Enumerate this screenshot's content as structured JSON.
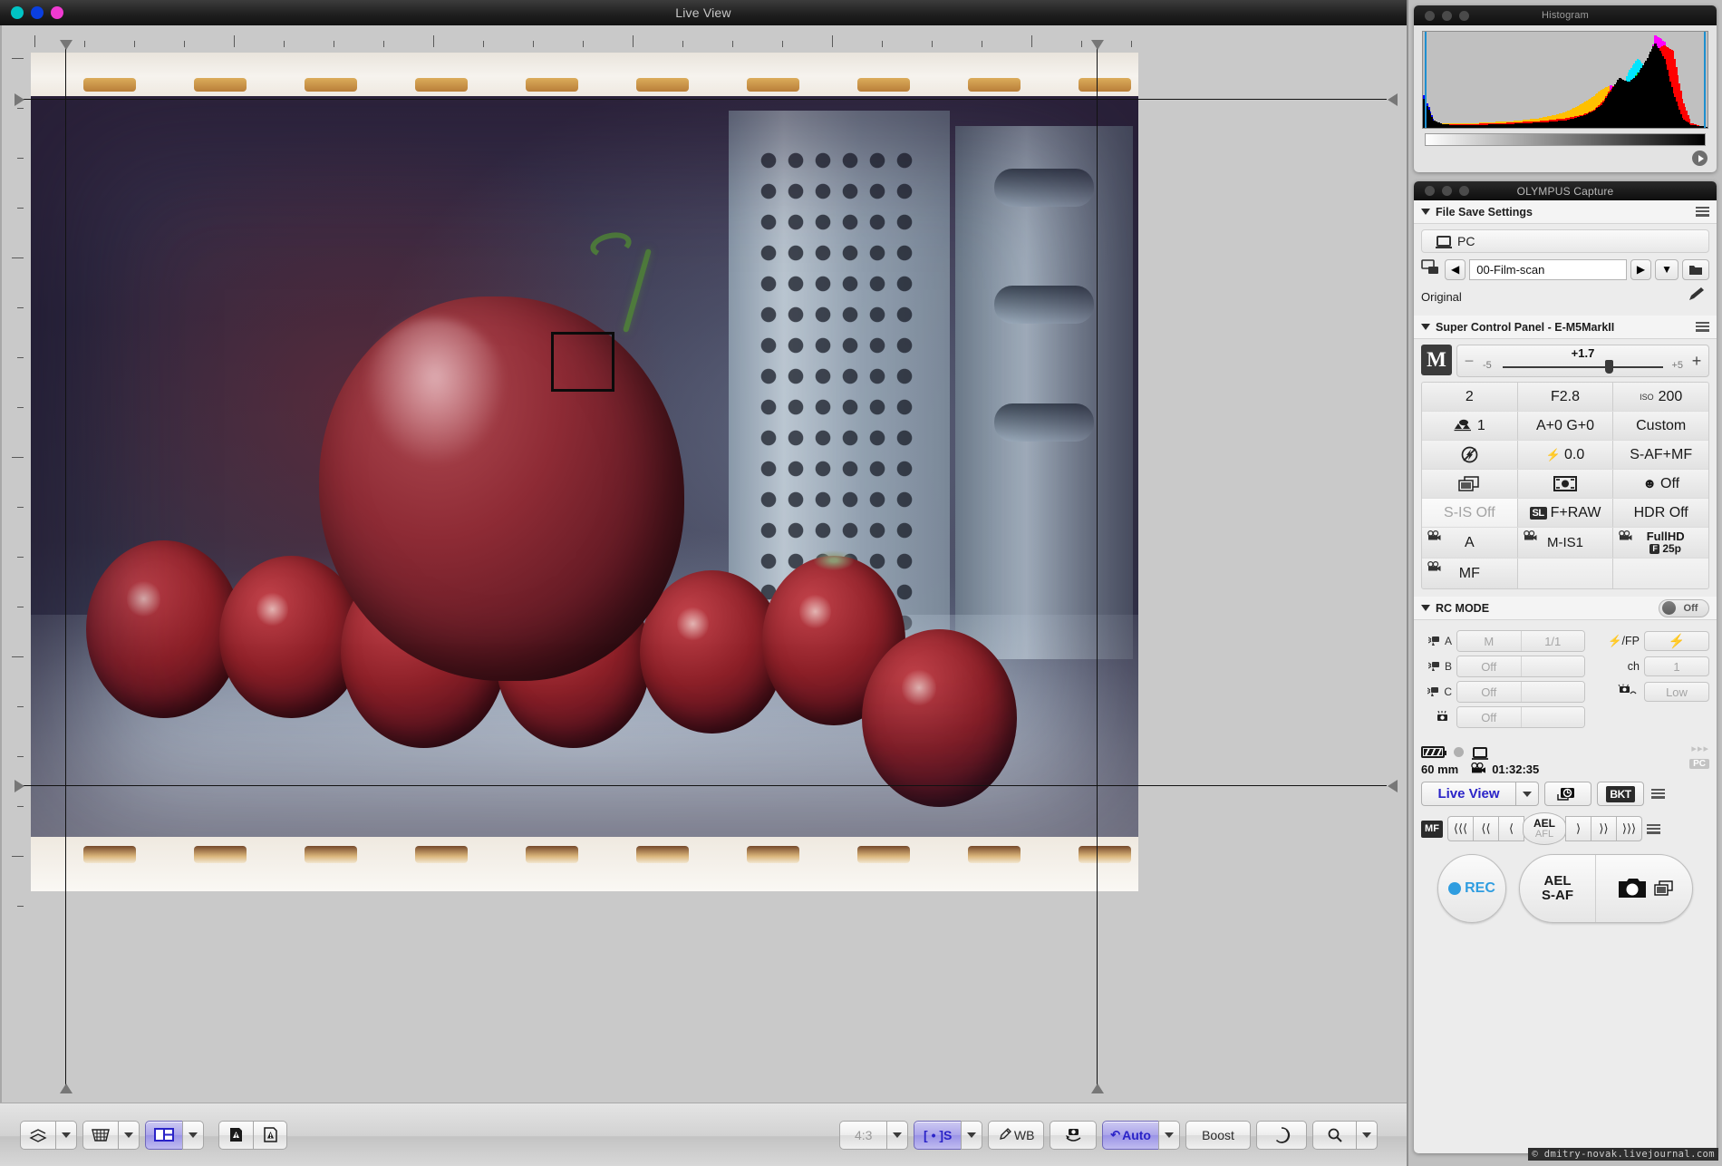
{
  "liveview": {
    "title": "Live View",
    "window_buttons": [
      "close",
      "minimize",
      "zoom"
    ],
    "af_box_label": "af-target",
    "toolbar": {
      "overlay_label": "overlay-compare",
      "grid_label": "grid-overlay",
      "split_label": "split-view",
      "warn_shadow_label": "shadow-warning",
      "warn_highlight_label": "highlight-warning",
      "aspect": "4:3",
      "af_mode": "[ • ]S",
      "wb_label": "WB",
      "rotate_label": "rotate-camera",
      "auto_label": "Auto",
      "boost_label": "Boost",
      "dof_label": "depth-of-field-preview",
      "zoom_label": "magnify"
    }
  },
  "histogram": {
    "title": "Histogram"
  },
  "capture": {
    "title": "OLYMPUS Capture",
    "file_save": {
      "header": "File Save Settings",
      "destination": "PC",
      "folder": "00-Film-scan",
      "naming": "Original"
    },
    "scp": {
      "header": "Super Control Panel - E-M5MarkII",
      "mode_badge": "M",
      "ev_value": "+1.7",
      "ev_min": "-5",
      "ev_max": "+5",
      "minus": "−",
      "plus": "+",
      "shutter": "2",
      "aperture": "F2.8",
      "iso_prefix": "ISO",
      "iso": "200",
      "picture_mode": "1",
      "wb_shift": "A+0 G+0",
      "wb_mode": "Custom",
      "flash_mode": "flash-off-icon",
      "flash_comp": "0.0",
      "af_mode": "S-AF+MF",
      "drive_mode": "sequential-icon",
      "metering": "metering-icon",
      "face_detect": "Off",
      "stabilizer": "S-IS Off",
      "quality_badge": "SL",
      "quality": "F+RAW",
      "hdr": "HDR Off",
      "movie_mode": "A",
      "movie_is": "M-IS1",
      "movie_quality_1": "FullHD",
      "movie_quality_badge": "F",
      "movie_quality_2": "25p",
      "movie_af": "MF"
    },
    "rc": {
      "header": "RC MODE",
      "toggle": "Off",
      "groups": [
        {
          "name": "A",
          "v1": "M",
          "v2": "1/1"
        },
        {
          "name": "B",
          "v1": "Off",
          "v2": ""
        },
        {
          "name": "C",
          "v1": "Off",
          "v2": ""
        },
        {
          "name": "camera",
          "v1": "Off",
          "v2": ""
        }
      ],
      "right": [
        {
          "label": "⚡/FP",
          "value": "⚡"
        },
        {
          "label": "ch",
          "value": "1"
        },
        {
          "label": "flash-level-icon",
          "value": "Low"
        }
      ]
    },
    "status": {
      "focal_length": "60 mm",
      "rec_time": "01:32:35",
      "pc_badge": "PC",
      "arrows": "▸▸▸"
    },
    "controls": {
      "live_view": "Live View",
      "interval_label": "interval-shooting",
      "bkt_label": "BKT",
      "mf_badge": "MF",
      "focus_steps": [
        "⟨⟨⟨",
        "⟨⟨",
        "⟨",
        "⟩",
        "⟩⟩",
        "⟩⟩⟩"
      ],
      "ael_top": "AEL",
      "ael_bottom": "AFL",
      "rec_button": "REC",
      "shutter_ael": "AEL",
      "shutter_af": "S-AF"
    }
  },
  "watermark": "© dmitry-novak.livejournal.com",
  "chart_data": {
    "type": "area",
    "title": "Histogram",
    "xlabel": "",
    "ylabel": "",
    "xlim": [
      0,
      255
    ],
    "ylim": [
      0,
      100
    ],
    "grid": false,
    "legend": "none",
    "x": [
      0,
      8,
      16,
      24,
      32,
      40,
      48,
      56,
      64,
      72,
      80,
      88,
      96,
      104,
      112,
      120,
      128,
      136,
      144,
      152,
      160,
      168,
      176,
      184,
      192,
      200,
      208,
      216,
      224,
      232,
      240,
      248,
      255
    ],
    "series": [
      {
        "name": "luminance",
        "color": "#000000",
        "values": [
          30,
          8,
          4,
          3,
          3,
          3,
          3,
          3,
          4,
          4,
          4,
          5,
          5,
          6,
          6,
          7,
          8,
          10,
          13,
          17,
          24,
          38,
          52,
          47,
          55,
          70,
          88,
          72,
          36,
          10,
          3,
          2,
          1
        ]
      },
      {
        "name": "red",
        "color": "#ff0000",
        "values": [
          26,
          7,
          4,
          4,
          4,
          4,
          4,
          5,
          5,
          5,
          6,
          6,
          7,
          7,
          8,
          9,
          10,
          12,
          14,
          18,
          26,
          40,
          50,
          44,
          52,
          66,
          80,
          86,
          80,
          30,
          5,
          2,
          1
        ]
      },
      {
        "name": "green",
        "color": "#00c000",
        "values": [
          28,
          7,
          3,
          3,
          3,
          3,
          3,
          3,
          4,
          4,
          4,
          4,
          5,
          5,
          5,
          6,
          7,
          8,
          10,
          13,
          20,
          33,
          45,
          40,
          58,
          56,
          48,
          30,
          12,
          4,
          2,
          1,
          1
        ]
      },
      {
        "name": "blue",
        "color": "#0000ff",
        "values": [
          34,
          9,
          3,
          2,
          2,
          2,
          2,
          2,
          2,
          3,
          3,
          3,
          3,
          4,
          4,
          4,
          5,
          6,
          7,
          9,
          14,
          38,
          46,
          38,
          30,
          22,
          14,
          8,
          4,
          2,
          1,
          1,
          1
        ]
      },
      {
        "name": "cyan",
        "color": "#00e5ff",
        "values": [
          22,
          4,
          2,
          1,
          1,
          1,
          1,
          1,
          1,
          1,
          1,
          2,
          2,
          2,
          2,
          2,
          3,
          3,
          4,
          5,
          7,
          12,
          30,
          58,
          72,
          62,
          66,
          30,
          8,
          3,
          1,
          1,
          1
        ]
      },
      {
        "name": "magenta",
        "color": "#ff00ff",
        "values": [
          18,
          3,
          1,
          1,
          1,
          1,
          1,
          1,
          1,
          1,
          1,
          1,
          1,
          1,
          2,
          2,
          2,
          3,
          3,
          4,
          6,
          44,
          36,
          30,
          34,
          40,
          96,
          90,
          34,
          6,
          2,
          1,
          1
        ]
      },
      {
        "name": "yellow",
        "color": "#ffc000",
        "values": [
          24,
          6,
          5,
          5,
          5,
          5,
          5,
          6,
          6,
          7,
          7,
          8,
          9,
          10,
          12,
          14,
          17,
          21,
          26,
          32,
          40,
          44,
          42,
          36,
          32,
          26,
          18,
          10,
          5,
          2,
          1,
          1,
          1
        ]
      }
    ],
    "markers": {
      "left": 0,
      "right": 255,
      "color": "#1d8fd0"
    }
  }
}
